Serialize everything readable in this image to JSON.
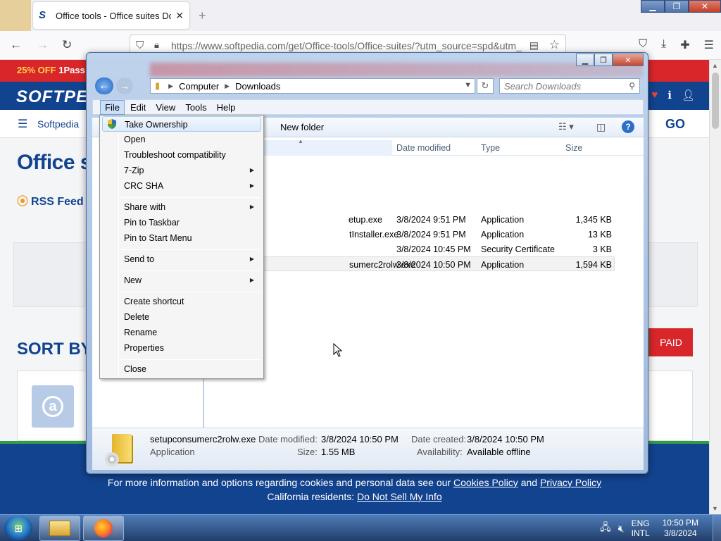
{
  "browser": {
    "tab_title": "Office tools - Office suites Dow",
    "url": "https://www.softpedia.com/get/Office-tools/Office-suites/?utm_source=spd&utm_"
  },
  "page": {
    "promo_a": "25% OFF",
    "promo_b": "1Pass",
    "logo": "SOFTPE",
    "nav_label": "Softpedia",
    "go": "GO",
    "title": "Office su",
    "rss": "RSS Feed",
    "sort_by": "SORT BY:",
    "paid": "PAID",
    "cookie_line1_a": "For more information and options regarding cookies and personal data see our ",
    "cookie_policy": "Cookies Policy",
    "cookie_and": " and ",
    "privacy_policy": "Privacy Policy",
    "cookie_line2_a": "California residents: ",
    "dnsmpi": "Do Not Sell My Info"
  },
  "explorer": {
    "breadcrumb": [
      "Computer",
      "Downloads"
    ],
    "search_placeholder": "Search Downloads",
    "menu": [
      "File",
      "Edit",
      "View",
      "Tools",
      "Help"
    ],
    "new_folder": "New folder",
    "columns": {
      "date": "Date modified",
      "type": "Type",
      "size": "Size"
    },
    "files": [
      {
        "name": "etup.exe",
        "date": "3/8/2024 9:51 PM",
        "type": "Application",
        "size": "1,345 KB"
      },
      {
        "name": "tInstaller.exe",
        "date": "3/8/2024 9:51 PM",
        "type": "Application",
        "size": "13 KB"
      },
      {
        "name": "",
        "date": "3/8/2024 10:45 PM",
        "type": "Security Certificate",
        "size": "3 KB"
      },
      {
        "name": "sumerc2rolw.exe",
        "date": "3/8/2024 10:50 PM",
        "type": "Application",
        "size": "1,594 KB"
      }
    ],
    "details": {
      "filename": "setupconsumerc2rolw.exe",
      "kind": "Application",
      "date_modified_label": "Date modified:",
      "date_modified": "3/8/2024 10:50 PM",
      "size_label": "Size:",
      "size": "1.55 MB",
      "date_created_label": "Date created:",
      "date_created": "3/8/2024 10:50 PM",
      "availability_label": "Availability:",
      "availability": "Available offline"
    }
  },
  "context_menu": {
    "items": [
      {
        "label": "Take Ownership",
        "submenu": false
      },
      {
        "label": "Open",
        "submenu": false
      },
      {
        "label": "Troubleshoot compatibility",
        "submenu": false
      },
      {
        "label": "7-Zip",
        "submenu": true
      },
      {
        "label": "CRC SHA",
        "submenu": true
      },
      {
        "label": "Share with",
        "submenu": true
      },
      {
        "label": "Pin to Taskbar",
        "submenu": false
      },
      {
        "label": "Pin to Start Menu",
        "submenu": false
      },
      {
        "label": "Send to",
        "submenu": true
      },
      {
        "label": "New",
        "submenu": true
      },
      {
        "label": "Create shortcut",
        "submenu": false
      },
      {
        "label": "Delete",
        "submenu": false
      },
      {
        "label": "Rename",
        "submenu": false
      },
      {
        "label": "Properties",
        "submenu": false
      },
      {
        "label": "Close",
        "submenu": false
      }
    ]
  },
  "taskbar": {
    "lang1": "ENG",
    "lang2": "INTL",
    "time": "10:50 PM",
    "date": "3/8/2024"
  }
}
